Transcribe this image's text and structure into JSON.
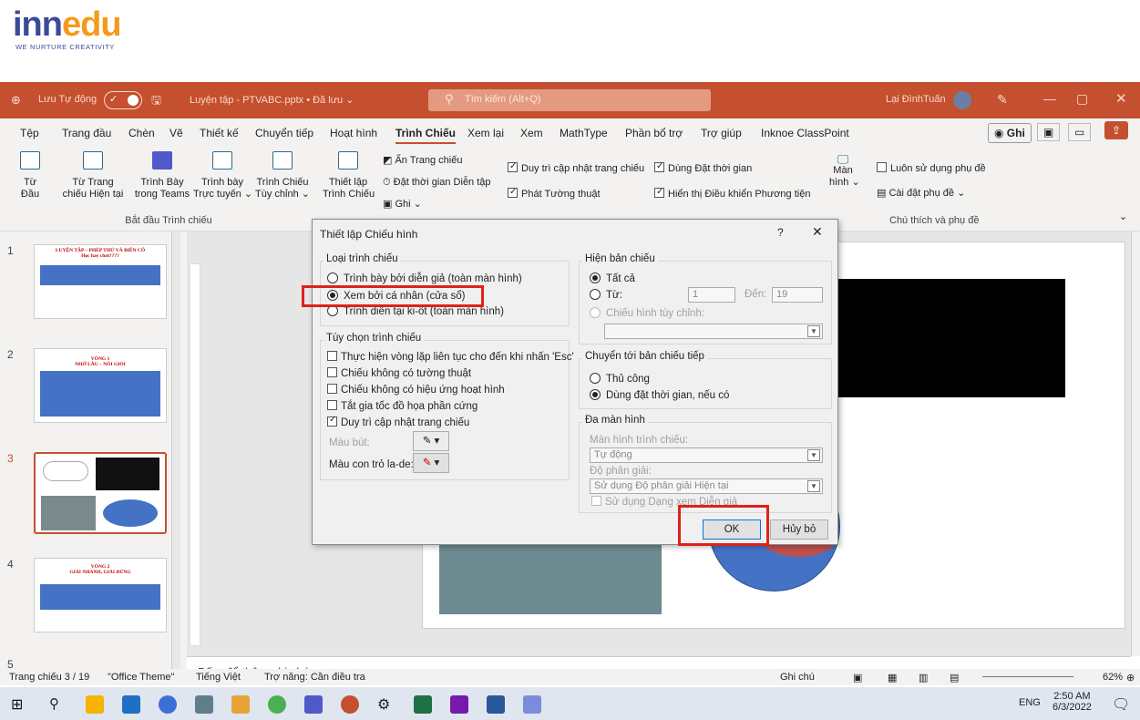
{
  "logo": {
    "brand_left": "inn",
    "brand_right": "edu",
    "tagline": "WE NURTURE CREATIVITY"
  },
  "titlebar": {
    "autosave": "Lưu Tự động",
    "toggle_on": "✓",
    "file": "Luyện tập - PTVABC.pptx • Đã lưu ⌄",
    "search_placeholder": "Tìm kiếm (Alt+Q)",
    "user": "Lại ĐìnhTuấn",
    "color": "#c4502f"
  },
  "menu": {
    "items": [
      "Tệp",
      "Trang đầu",
      "Chèn",
      "Vẽ",
      "Thiết kế",
      "Chuyển tiếp",
      "Hoạt hình",
      "Trình Chiếu",
      "Xem lại",
      "Xem",
      "MathType",
      "Phần bổ trợ",
      "Trợ giúp",
      "Inknoe ClassPoint"
    ],
    "active": "Trình Chiếu",
    "record": "◉ Ghi"
  },
  "ribbon": {
    "b1": "Từ\nĐầu",
    "b2": "Từ Trang\nchiếu Hiện tại",
    "b3": "Trình Bày\ntrong Teams",
    "b4": "Trình bày\nTrực tuyến ⌄",
    "b5": "Trình Chiếu\nTùy chỉnh ⌄",
    "group1": "Bắt đầu Trình chiếu",
    "setup": "Thiết lập\nTrình Chiếu",
    "hide": "Ẩn Trang chiếu",
    "rehearse": "Đặt thời gian Diễn tập",
    "record": "Ghi ⌄",
    "c1": "Duy trì cập nhật trang chiếu",
    "c2": "Phát Tường thuật",
    "c3": "Dùng Đặt thời gian",
    "c4": "Hiển thị Điều khiển Phương tiện",
    "monitor": "Màn\nhình ⌄",
    "subs_always": "Luôn sử dụng phụ đề",
    "subs_settings": "Cài đặt phụ đề ⌄",
    "group_subs": "Chú thích và phụ đề"
  },
  "thumbs": [
    {
      "n": "1",
      "title": "LUYỆN TẬP – PHÉP THỬ VÀ BIẾN CỐ\nHọc hay chơi????"
    },
    {
      "n": "2",
      "title": "VÒNG 1\nNHỚ LÂU – NÓI GIỎI"
    },
    {
      "n": "3",
      "title": ""
    },
    {
      "n": "4",
      "title": "VÒNG 2\nGIẢI NHANH, GIẢI ĐÚNG"
    },
    {
      "n": "5",
      "title": ""
    }
  ],
  "notes": "Bấm để thêm ghi chú",
  "status": {
    "slide": "Trang chiếu 3 / 19",
    "theme": "\"Office Theme\"",
    "lang": "Tiếng Việt",
    "access": "Trợ năng: Cần điều tra",
    "notes_btn": "Ghi chú",
    "zoom": "62%"
  },
  "taskbar": {
    "time": "2:50 AM",
    "date": "6/3/2022",
    "lang": "ENG"
  },
  "dialog": {
    "title": "Thiết lập Chiếu hình",
    "help": "?",
    "close": "✕",
    "type_group": "Loại trình chiếu",
    "type_opts": [
      "Trình bày bởi diễn giả (toàn màn hình)",
      "Xem bởi cá nhân (cửa sổ)",
      "Trình diễn tại ki-ốt (toàn màn hình)"
    ],
    "show_group": "Hiện bản chiếu",
    "show_all": "Tất cả",
    "show_from": "Từ:",
    "from_val": "1",
    "to_label": "Đến:",
    "to_val": "19",
    "custom": "Chiếu hình tùy chỉnh:",
    "opts_group": "Tùy chọn trình chiếu",
    "opts": [
      "Thực hiện vòng lặp liên tục cho đến khi nhấn 'Esc'",
      "Chiếu không có tường thuật",
      "Chiếu không có hiệu ứng hoạt hình",
      "Tắt gia tốc đồ họa phần cứng",
      "Duy trì cập nhật trang chiếu"
    ],
    "pen": "Màu bút:",
    "laser": "Màu con trỏ la-de:",
    "adv_group": "Chuyển tới bản chiếu tiếp",
    "adv_manual": "Thủ công",
    "adv_timing": "Dùng đặt thời gian, nếu có",
    "multi_group": "Đa màn hình",
    "monitor_label": "Màn hình trình chiếu:",
    "monitor_val": "Tự động",
    "res_label": "Độ phân giải:",
    "res_val": "Sử dụng Độ phân giải Hiện tại",
    "presenter": "Sử dụng Dạng xem Diễn giả",
    "ok": "OK",
    "cancel": "Hủy bỏ"
  }
}
